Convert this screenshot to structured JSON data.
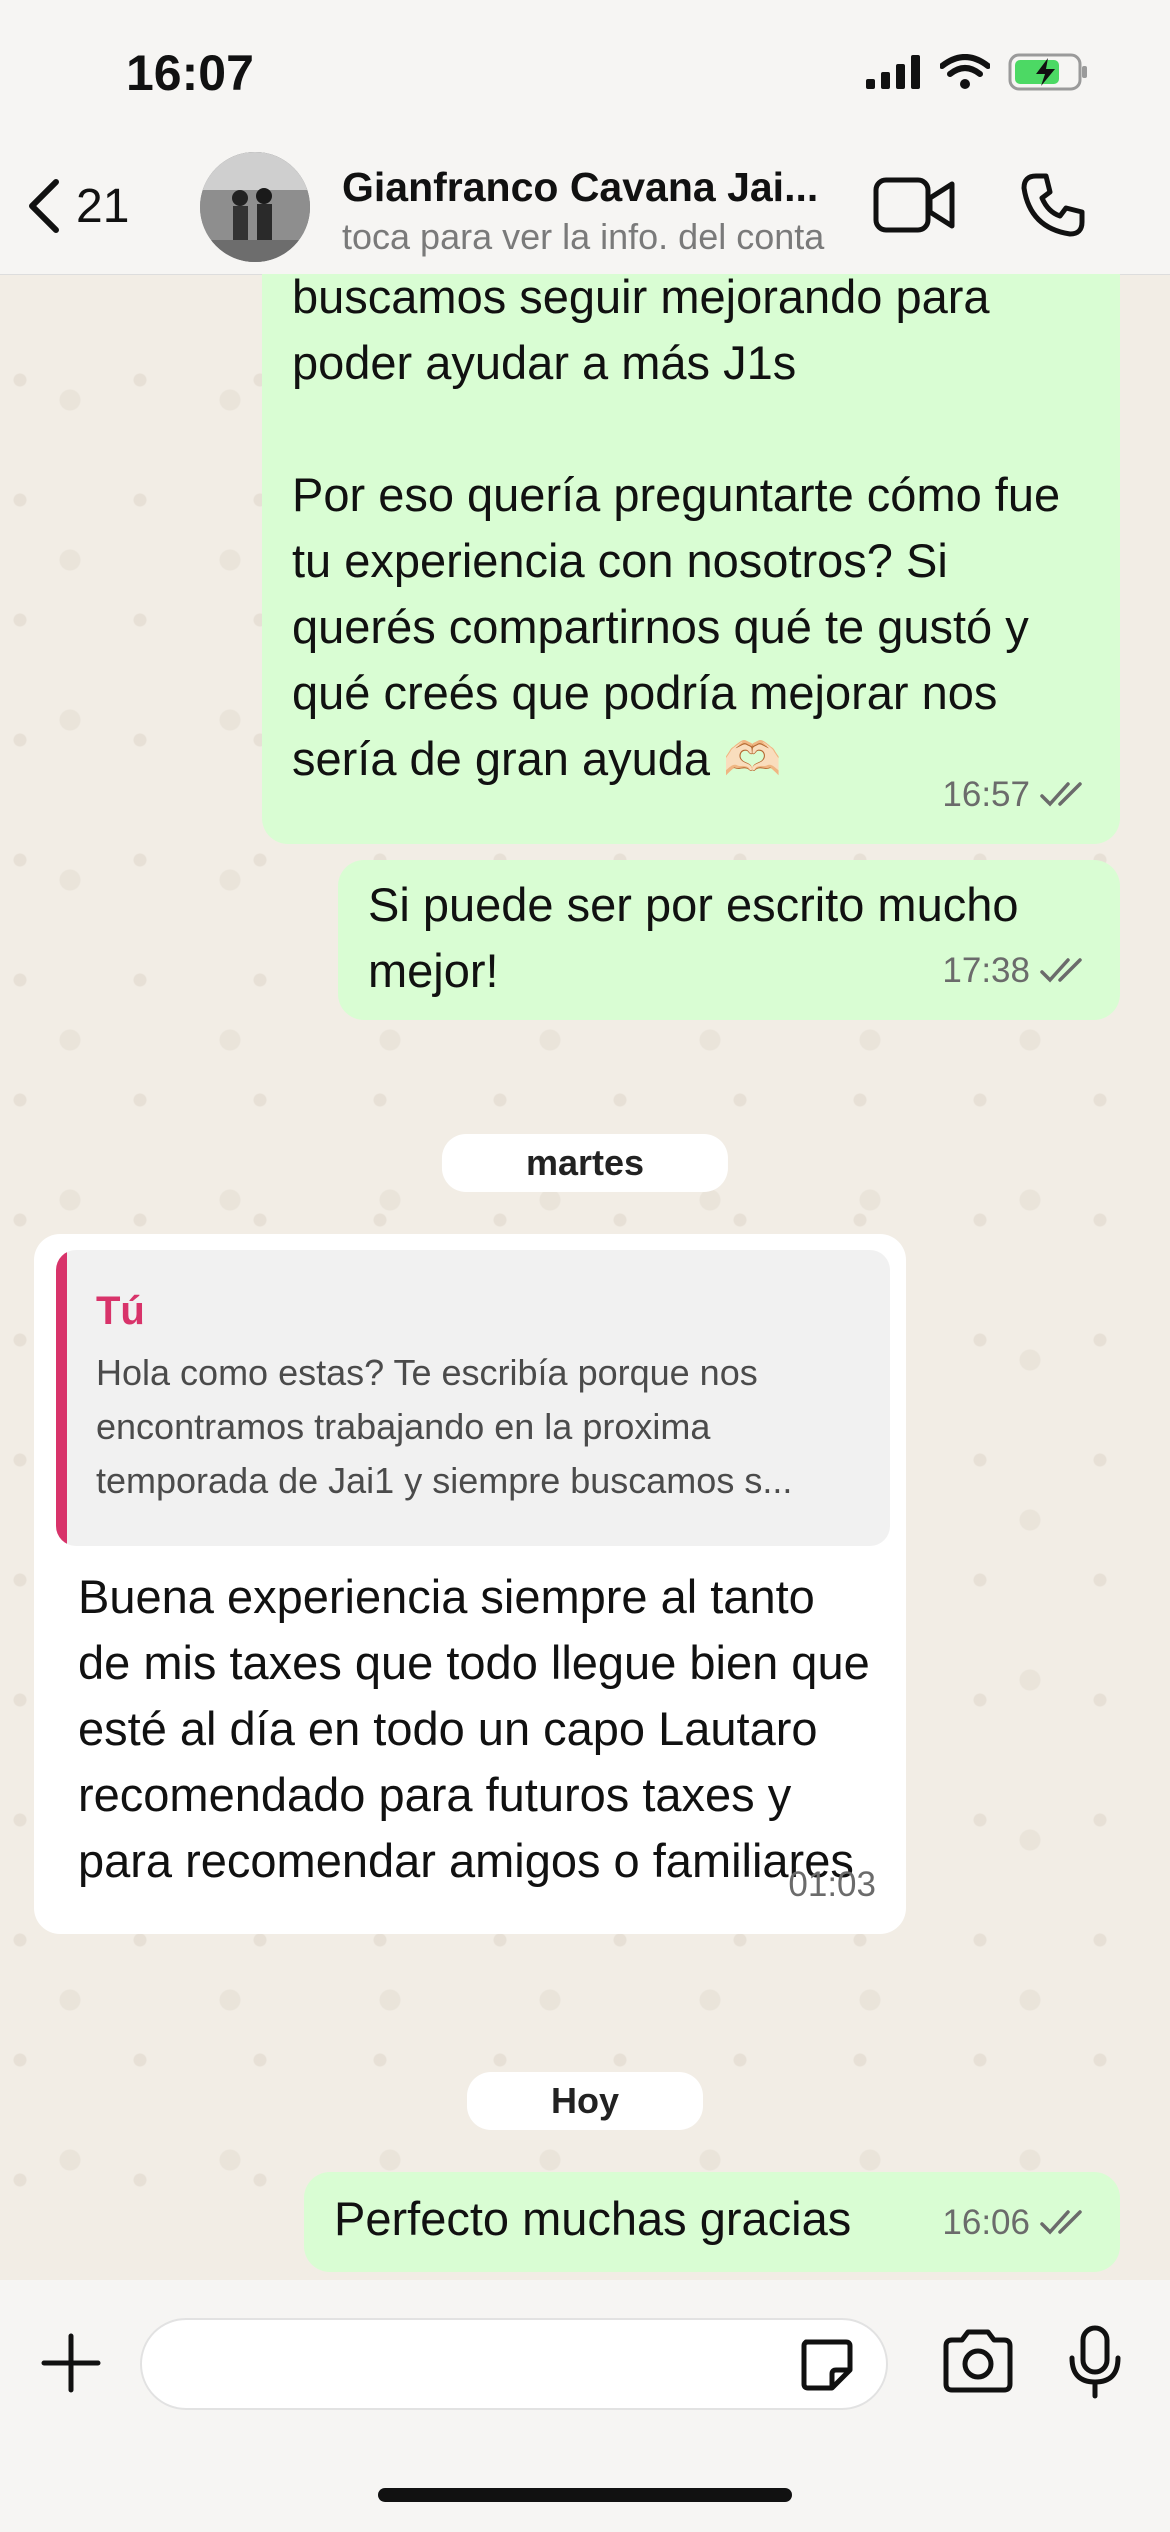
{
  "status_bar": {
    "time": "16:07",
    "icons": [
      "signal-icon",
      "wifi-icon",
      "battery-charging-icon"
    ]
  },
  "header": {
    "back_count": "21",
    "contact_name": "Gianfranco Cavana Jai...",
    "subtitle": "toca para ver la info. del conta",
    "actions": [
      "video-call-icon",
      "phone-call-icon"
    ]
  },
  "messages": [
    {
      "direction": "outgoing",
      "text": "buscamos seguir mejorando para\npoder ayudar a más J1s\n\nPor eso quería preguntarte cómo fue tu experiencia con nosotros? Si querés compartirnos qué te gustó y qué creés que podría mejorar nos sería de gran ayuda 🫶🏻",
      "time": "16:57",
      "read": true
    },
    {
      "direction": "outgoing",
      "text": "Si puede ser por escrito mucho mejor!",
      "time": "17:38",
      "read": true
    },
    {
      "type": "day",
      "label": "martes"
    },
    {
      "direction": "incoming",
      "quote": {
        "author": "Tú",
        "text": "Hola como estas? Te escribía porque nos encontramos trabajando en la proxima temporada de Jai1 y siempre buscamos s..."
      },
      "text": "Buena experiencia siempre al tanto de mis taxes que todo llegue bien que esté al día en todo un capo Lautaro recomendado para futuros taxes y para recomendar amigos o familiares",
      "time": "01:03"
    },
    {
      "type": "day",
      "label": "Hoy"
    },
    {
      "direction": "outgoing",
      "text": "Perfecto muchas gracias",
      "time": "16:06",
      "read": true
    }
  ],
  "composer": {
    "value": "",
    "buttons": [
      "add-icon",
      "sticker-icon",
      "camera-icon",
      "microphone-icon"
    ]
  },
  "colors": {
    "outgoing_bubble": "#d9fdd3",
    "incoming_bubble": "#ffffff",
    "quote_accent": "#d8336a",
    "read_tick": "#6b6b6b"
  }
}
